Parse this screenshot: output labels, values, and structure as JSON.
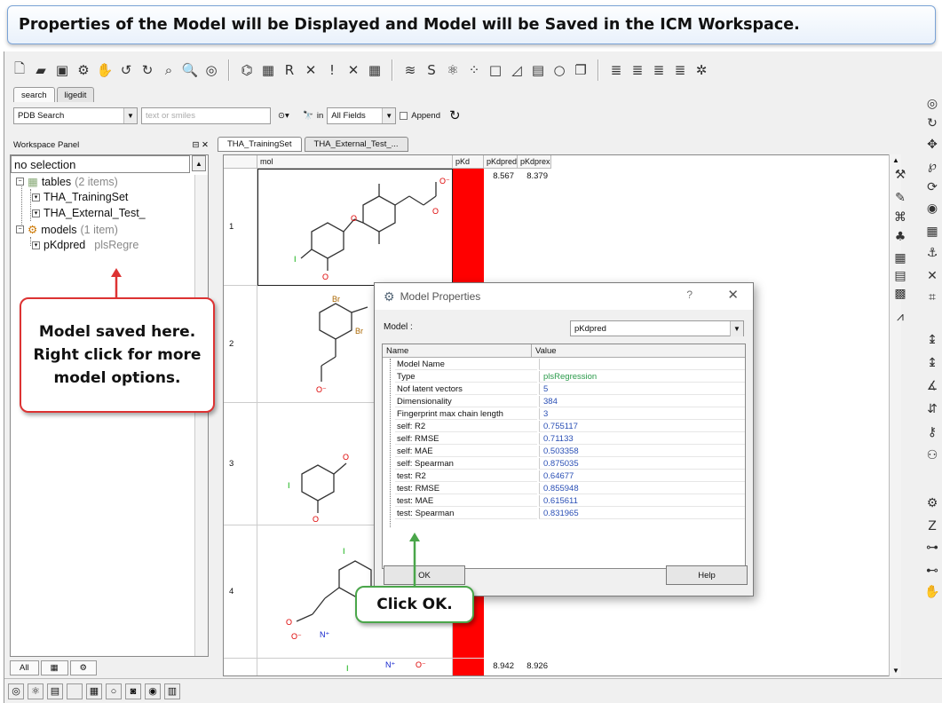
{
  "banner": {
    "text": "Properties of the Model will be Displayed and Model will be Saved in the ICM Workspace."
  },
  "search_tabs": [
    "search",
    "ligedit"
  ],
  "search_row": {
    "source": "PDB Search",
    "query_placeholder": "text or smiles",
    "in_label": "in",
    "field": "All Fields",
    "append_label": "Append"
  },
  "workspace": {
    "title": "Workspace Panel",
    "selection": "no selection",
    "tables_label": "tables",
    "tables_count": "(2 items)",
    "tables": [
      "THA_TrainingSet",
      "THA_External_Test_"
    ],
    "models_label": "models",
    "models_count": "(1 item)",
    "model_name": "pKdpred",
    "model_type": "plsRegre",
    "bottom_tab": "All"
  },
  "table_tabs": [
    "THA_TrainingSet",
    "THA_External_Test_..."
  ],
  "grid": {
    "columns": [
      "mol",
      "pKd",
      "pKdpred",
      "pKdprex"
    ],
    "rows": [
      {
        "num": "1",
        "pkdpred": "8.567",
        "pkdprex": "8.379"
      },
      {
        "num": "2",
        "pkdpred": "",
        "pkdprex": ""
      },
      {
        "num": "3",
        "pkdpred": "",
        "pkdprex": ""
      },
      {
        "num": "4",
        "pkdpred": "",
        "pkdprex": ""
      },
      {
        "num": "",
        "pkdpred": "8.942",
        "pkdprex": "8.926"
      }
    ],
    "pkd_color": "#ff0000"
  },
  "dialog": {
    "title": "Model Properties",
    "help_q": "?",
    "close": "✕",
    "model_label": "Model :",
    "model_value": "pKdpred",
    "col_name": "Name",
    "col_value": "Value",
    "properties": [
      {
        "name": "Model Name",
        "value": ""
      },
      {
        "name": "Type",
        "value": "plsRegression"
      },
      {
        "name": "Nof latent vectors",
        "value": "5"
      },
      {
        "name": "Dimensionality",
        "value": "384"
      },
      {
        "name": "Fingerprint max chain length",
        "value": "3"
      },
      {
        "name": "self: R2",
        "value": "0.755117"
      },
      {
        "name": "self: RMSE",
        "value": "0.71133"
      },
      {
        "name": "self: MAE",
        "value": "0.503358"
      },
      {
        "name": "self: Spearman",
        "value": "0.875035"
      },
      {
        "name": "test: R2",
        "value": "0.64677"
      },
      {
        "name": "test: RMSE",
        "value": "0.855948"
      },
      {
        "name": "test: MAE",
        "value": "0.615611"
      },
      {
        "name": "test: Spearman",
        "value": "0.831965"
      }
    ],
    "ok_label": "OK",
    "help_label": "Help"
  },
  "callouts": {
    "saved": "Model saved here. Right click for more model options.",
    "ok": "Click OK."
  }
}
